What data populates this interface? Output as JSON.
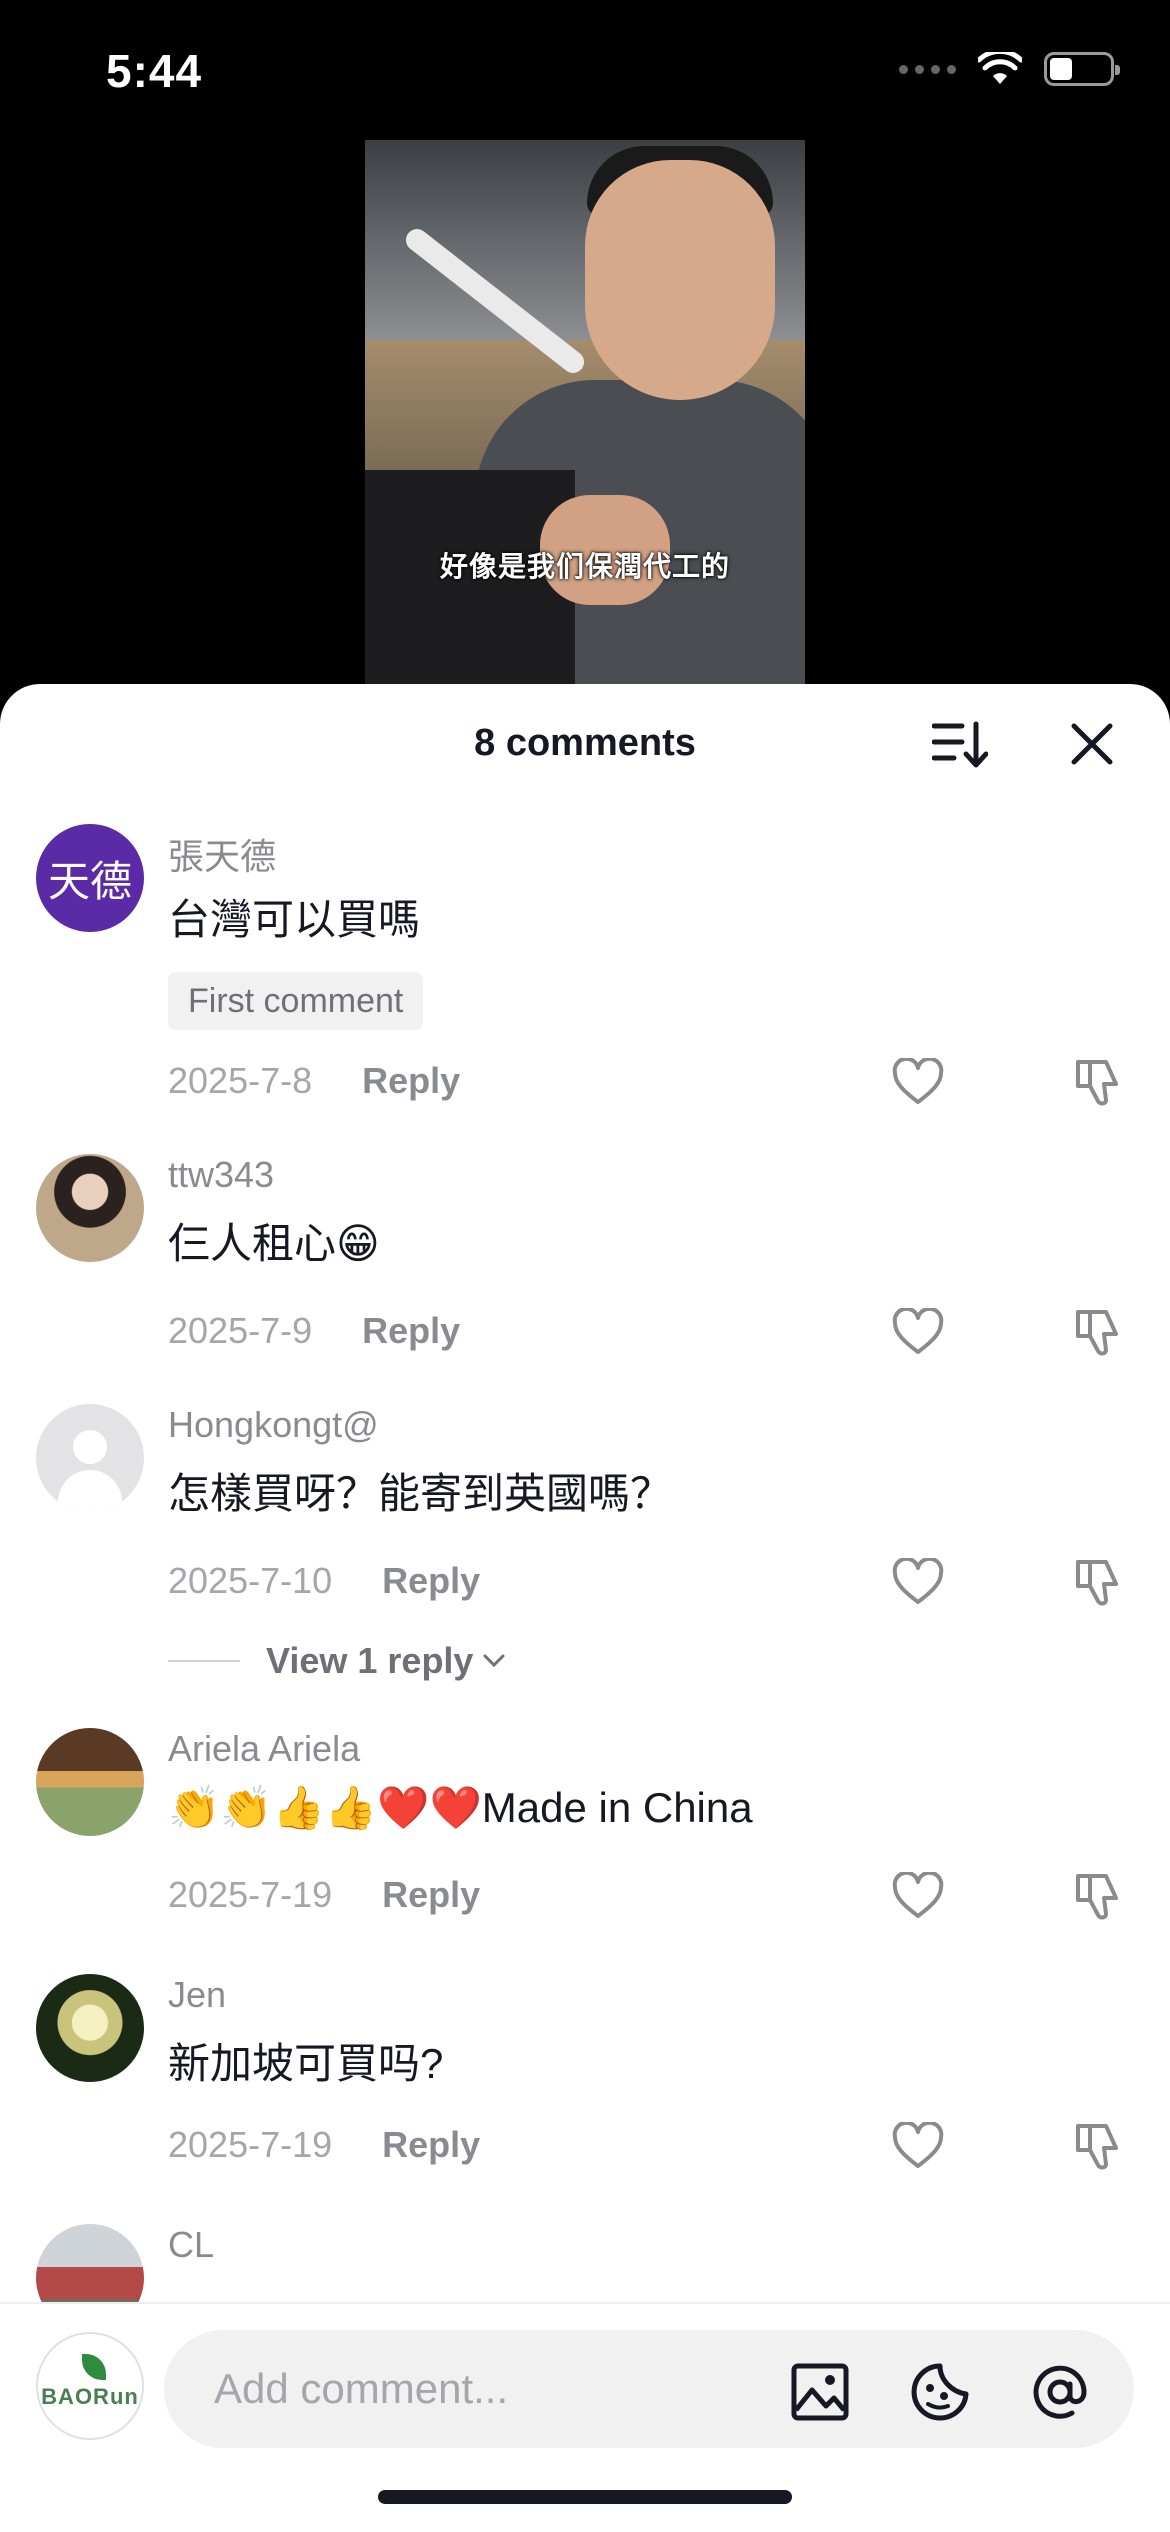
{
  "status_bar": {
    "time": "5:44"
  },
  "video": {
    "caption": "好像是我们保潤代工的"
  },
  "sheet": {
    "title": "8 comments"
  },
  "comments": [
    {
      "username": "張天德",
      "avatar_text": "天德",
      "text": "台灣可以買嗎",
      "badge": "First comment",
      "date": "2025-7-8",
      "reply_label": "Reply"
    },
    {
      "username": "ttw343",
      "text": "仨人租心😁",
      "date": "2025-7-9",
      "reply_label": "Reply"
    },
    {
      "username": "Hongkongt@",
      "text": "怎樣買呀？能寄到英國嗎？",
      "date": "2025-7-10",
      "reply_label": "Reply",
      "view_replies": "View 1 reply"
    },
    {
      "username": "Ariela Ariela",
      "text": "👏👏👍👍❤️❤️Made in China",
      "date": "2025-7-19",
      "reply_label": "Reply"
    },
    {
      "username": "Jen",
      "text": "新加坡可買吗?",
      "date": "2025-7-19",
      "reply_label": "Reply"
    },
    {
      "username": "CL"
    }
  ],
  "input_bar": {
    "placeholder": "Add comment...",
    "self_avatar_text": "BAORun"
  },
  "icons": {
    "sort": "sort-icon",
    "close": "close-icon",
    "like": "heart-icon",
    "dislike": "thumbs-down-icon",
    "image": "image-icon",
    "sticker": "sticker-icon",
    "mention": "at-icon"
  },
  "colors": {
    "text_primary": "#161823",
    "text_secondary": "#8a8b91",
    "avatar_purple": "#5b2aa6"
  }
}
